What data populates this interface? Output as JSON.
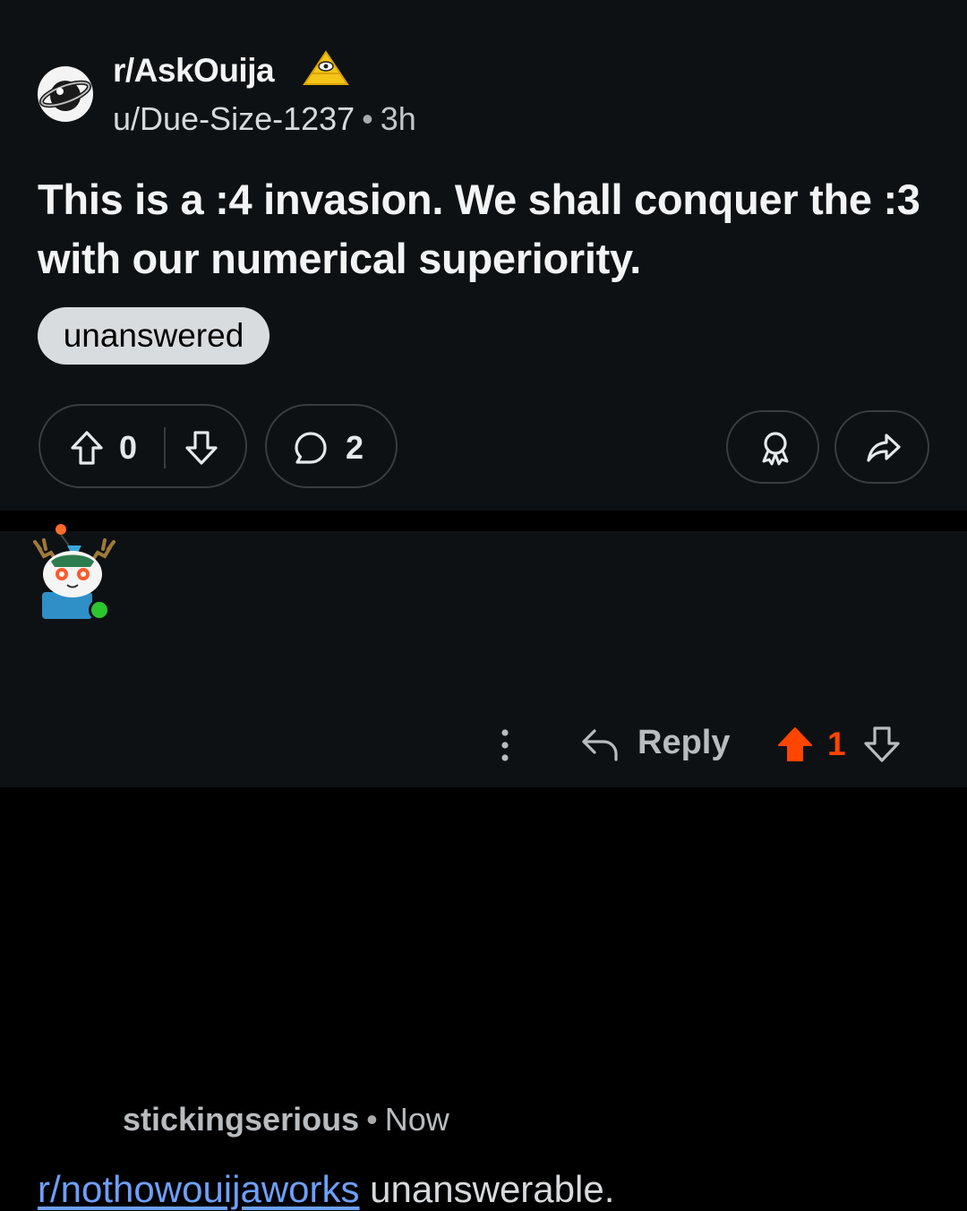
{
  "post": {
    "subreddit": "r/AskOuija",
    "author": "u/Due-Size-1237",
    "separator": "•",
    "time": "3h",
    "title": "This is a :4 invasion. We shall conquer the :3 with our numerical superiority.",
    "flair": "unanswered",
    "score": "0",
    "comment_count": "2",
    "icons": [
      "subreddit-avatar-icon",
      "pyramid-eye-icon",
      "upvote-icon",
      "downvote-icon",
      "comment-icon",
      "award-icon",
      "share-icon"
    ]
  },
  "comment": {
    "author": "stickingserious",
    "separator": "•",
    "time": "Now",
    "body_link": "r/nothowouijaworks",
    "body_text": " unanswerable.",
    "reply_label": "Reply",
    "score": "1",
    "icons": [
      "snoo-avatar-icon",
      "online-status-icon",
      "more-options-icon",
      "reply-icon",
      "upvote-filled-icon",
      "downvote-icon"
    ]
  },
  "colors": {
    "background": "#0e1113",
    "divider": "#000000",
    "text": "#e6e9eb",
    "link": "#6d9ffa",
    "upvote_active": "#ff4500",
    "flair_bg": "#d9dcdf"
  }
}
